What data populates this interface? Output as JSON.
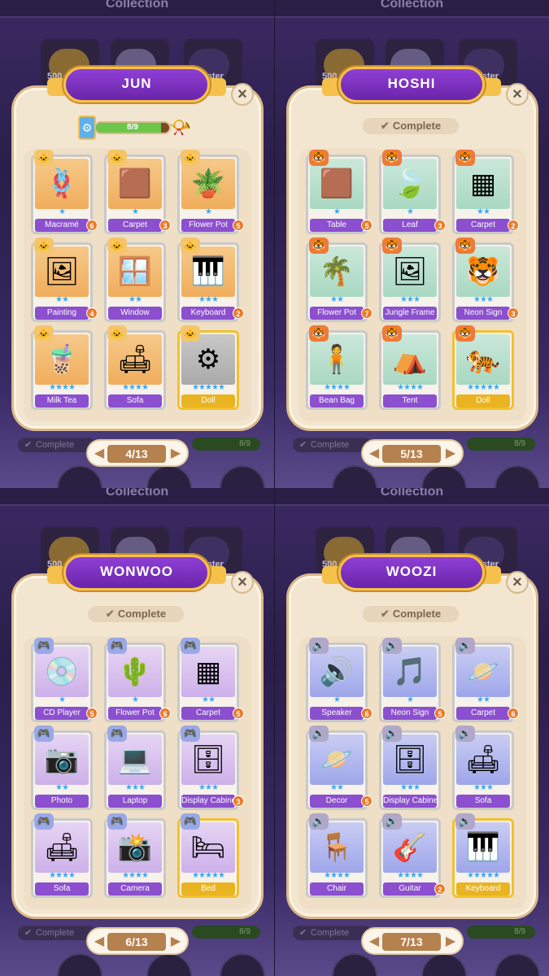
{
  "background": {
    "title": "Collection",
    "coin_count": "500",
    "booster_label": "oster",
    "complete_label": "Complete",
    "progress_value": "8/9"
  },
  "panels": [
    {
      "title": "JUN",
      "header_type": "progress",
      "progress": {
        "text": "8/9",
        "fraction": 0.889
      },
      "page": "4/13",
      "badge_icon": "cat-icon",
      "palette": "orange",
      "cards": [
        {
          "name": "Macramé",
          "stars": 1,
          "count": "6",
          "glyph": "🪢"
        },
        {
          "name": "Carpet",
          "stars": 1,
          "count": "3",
          "glyph": "🟫"
        },
        {
          "name": "Flower Pot",
          "stars": 1,
          "count": "5",
          "glyph": "🪴"
        },
        {
          "name": "Painting",
          "stars": 2,
          "count": "4",
          "glyph": "🖼"
        },
        {
          "name": "Window",
          "stars": 2,
          "count": "",
          "glyph": "🪟"
        },
        {
          "name": "Keyboard",
          "stars": 3,
          "count": "2",
          "glyph": "🎹"
        },
        {
          "name": "Milk Tea",
          "stars": 4,
          "count": "",
          "glyph": "🧋"
        },
        {
          "name": "Sofa",
          "stars": 4,
          "count": "",
          "glyph": "🛋"
        },
        {
          "name": "Doll",
          "stars": 5,
          "count": "",
          "glyph": "⚙",
          "locked": true
        }
      ]
    },
    {
      "title": "HOSHI",
      "header_type": "complete",
      "complete_text": "Complete",
      "page": "5/13",
      "badge_icon": "tiger-icon",
      "palette": "mint",
      "cards": [
        {
          "name": "Table",
          "stars": 1,
          "count": "5",
          "glyph": "🟫"
        },
        {
          "name": "Leaf",
          "stars": 1,
          "count": "3",
          "glyph": "🍃"
        },
        {
          "name": "Carpet",
          "stars": 2,
          "count": "2",
          "glyph": "▦"
        },
        {
          "name": "Flower Pot",
          "stars": 2,
          "count": "7",
          "glyph": "🌴"
        },
        {
          "name": "Jungle Frame",
          "stars": 3,
          "count": "",
          "glyph": "🖼"
        },
        {
          "name": "Neon Sign",
          "stars": 3,
          "count": "3",
          "glyph": "🐯"
        },
        {
          "name": "Bean Bag",
          "stars": 4,
          "count": "",
          "glyph": "🧍"
        },
        {
          "name": "Tent",
          "stars": 4,
          "count": "",
          "glyph": "⛺"
        },
        {
          "name": "Doll",
          "stars": 5,
          "count": "",
          "glyph": "🐅",
          "gold": true
        }
      ]
    },
    {
      "title": "WONWOO",
      "header_type": "complete",
      "complete_text": "Complete",
      "page": "6/13",
      "badge_icon": "gameboy-icon",
      "palette": "violet",
      "cards": [
        {
          "name": "CD Player",
          "stars": 1,
          "count": "5",
          "glyph": "💿"
        },
        {
          "name": "Flower Pot",
          "stars": 1,
          "count": "6",
          "glyph": "🌵"
        },
        {
          "name": "Carpet",
          "stars": 2,
          "count": "5",
          "glyph": "▦"
        },
        {
          "name": "Photo",
          "stars": 2,
          "count": "",
          "glyph": "📷"
        },
        {
          "name": "Laptop",
          "stars": 3,
          "count": "",
          "glyph": "💻"
        },
        {
          "name": "Display Cabinet",
          "stars": 3,
          "count": "3",
          "glyph": "🗄"
        },
        {
          "name": "Sofa",
          "stars": 4,
          "count": "",
          "glyph": "🛋"
        },
        {
          "name": "Camera",
          "stars": 4,
          "count": "",
          "glyph": "📸"
        },
        {
          "name": "Bed",
          "stars": 5,
          "count": "",
          "glyph": "🛏",
          "gold": true
        }
      ]
    },
    {
      "title": "WOOZI",
      "header_type": "complete",
      "complete_text": "Complete",
      "page": "7/13",
      "badge_icon": "speaker-icon",
      "palette": "blue",
      "cards": [
        {
          "name": "Speaker",
          "stars": 1,
          "count": "6",
          "glyph": "🔊"
        },
        {
          "name": "Neon Sign",
          "stars": 1,
          "count": "5",
          "glyph": "🎵"
        },
        {
          "name": "Carpet",
          "stars": 2,
          "count": "6",
          "glyph": "🪐"
        },
        {
          "name": "Decor",
          "stars": 2,
          "count": "5",
          "glyph": "🪐"
        },
        {
          "name": "Display Cabinet",
          "stars": 3,
          "count": "",
          "glyph": "🗄"
        },
        {
          "name": "Sofa",
          "stars": 3,
          "count": "",
          "glyph": "🛋"
        },
        {
          "name": "Chair",
          "stars": 4,
          "count": "",
          "glyph": "🪑"
        },
        {
          "name": "Guitar",
          "stars": 4,
          "count": "2",
          "glyph": "🎸"
        },
        {
          "name": "Keyboard",
          "stars": 5,
          "count": "",
          "glyph": "🎹",
          "gold": true
        }
      ]
    }
  ]
}
